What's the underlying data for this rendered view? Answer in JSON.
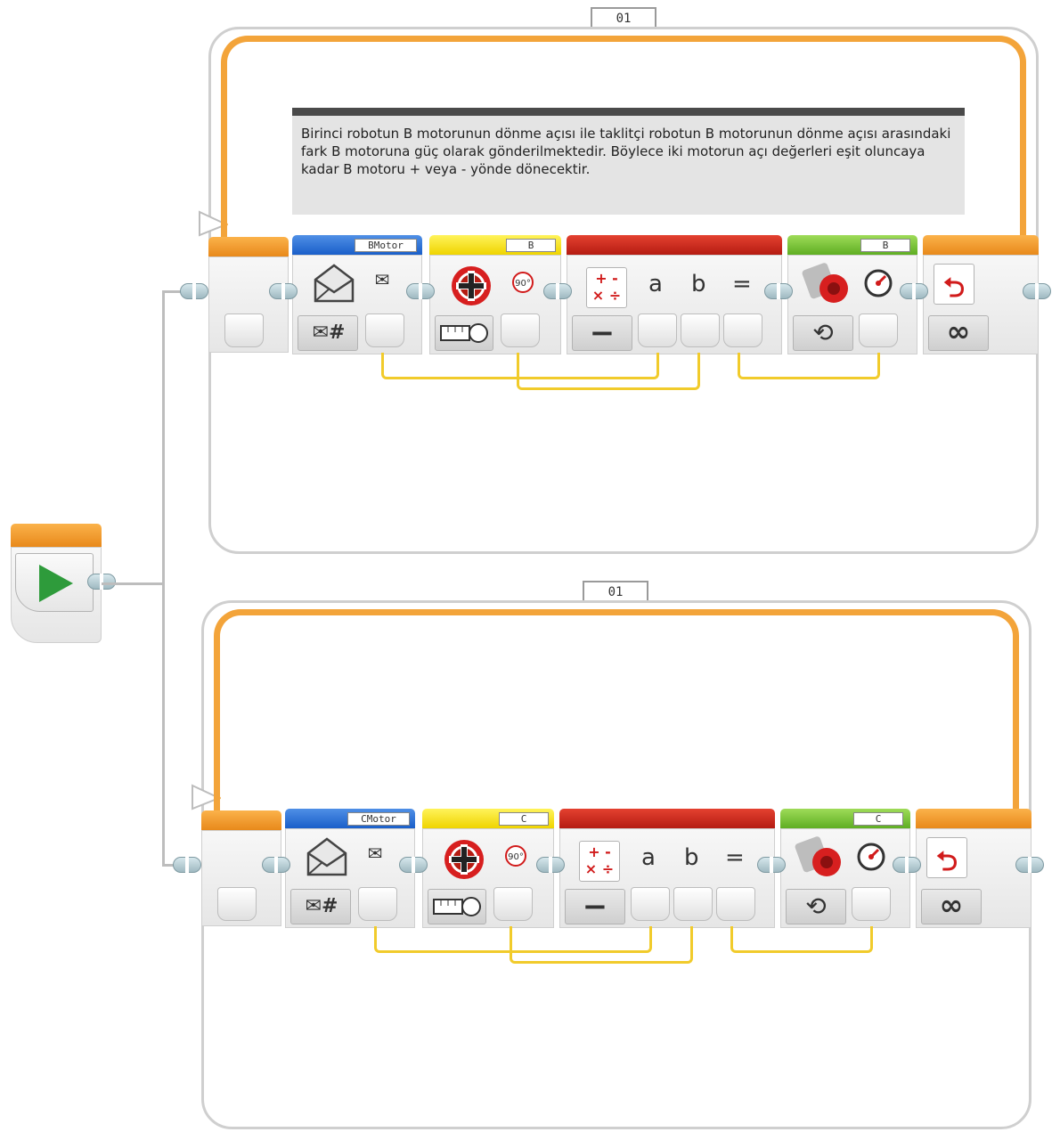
{
  "start_block": {
    "icon": "play-icon"
  },
  "loops": [
    {
      "label": "01",
      "comment": "Birinci robotun B motorunun dönme açısı ile taklitçi robotun B motorunun dönme açısı arasındaki fark B motoruna güç olarak gönderilmektedir. Böylece iki motorun açı değerleri eşit oluncaya kadar B motoru + veya - yönde dönecektir.",
      "message_name": "BMotor",
      "rotation_port": "B",
      "motor_port": "B",
      "math_a": "a",
      "math_b": "b",
      "math_eq": "=",
      "math_mode": "−",
      "loop_mode": "∞"
    },
    {
      "label": "01",
      "message_name": "CMotor",
      "rotation_port": "C",
      "motor_port": "C",
      "math_a": "a",
      "math_b": "b",
      "math_eq": "=",
      "math_mode": "−",
      "loop_mode": "∞"
    }
  ],
  "colors": {
    "loop_orange": "#f3a43a",
    "messaging_blue": "#1a5fc9",
    "sensor_yellow": "#efd400",
    "math_red": "#b51c12",
    "motor_green": "#5fae23",
    "wire_yellow": "#f1cb2b",
    "start_green": "#2e9b3b"
  },
  "icons": [
    "play-icon",
    "envelope-icon",
    "mail-icon",
    "number-type-icon",
    "rotation-sensor-icon",
    "degrees-icon",
    "measure-mode-icon",
    "math-icon",
    "motor-icon",
    "speed-icon",
    "rotate-icon",
    "loop-icon",
    "infinity-icon"
  ]
}
